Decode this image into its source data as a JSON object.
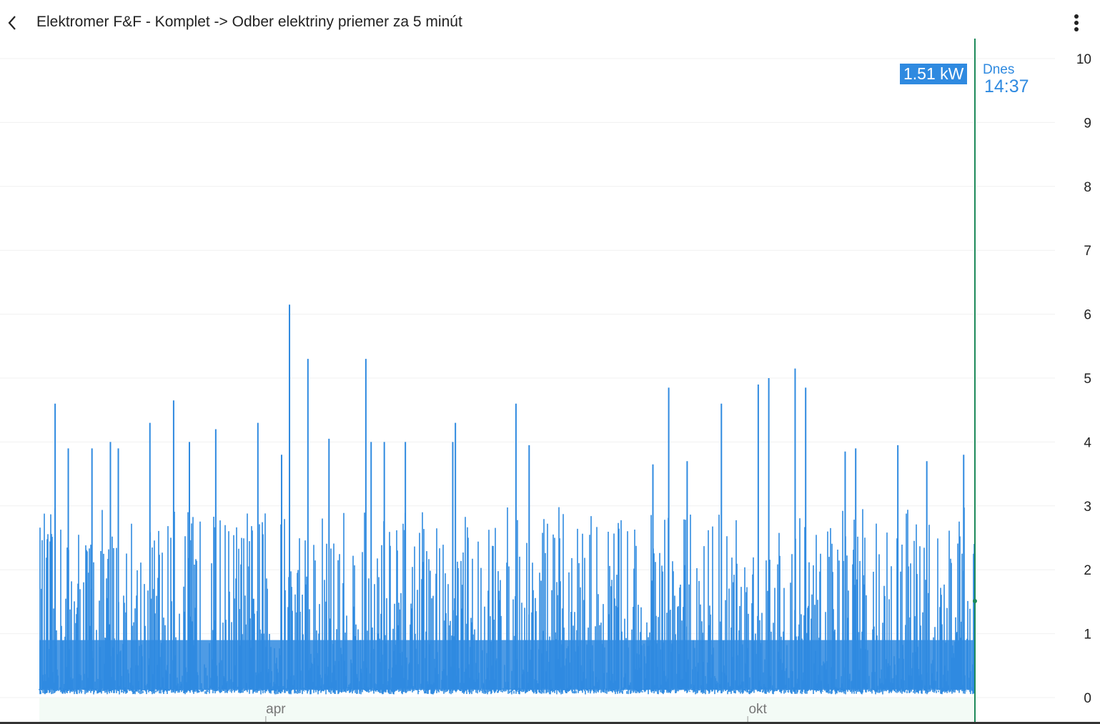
{
  "header": {
    "title": "Elektromer F&F - Komplet -> Odber elektriny priemer za 5 minút",
    "back_icon": "chevron-left-icon",
    "menu_icon": "more-vertical-icon"
  },
  "cursor": {
    "value_label": "1.51 kW",
    "day_label": "Dnes",
    "time_label": "14:37",
    "value": 1.51,
    "line_color": "#1e8a5a"
  },
  "chart_data": {
    "type": "line",
    "title": "Odber elektriny priemer za 5 minút",
    "unit": "kW",
    "series_color": "#2f8ae0",
    "ylim": [
      0,
      10
    ],
    "yticks": [
      "0",
      "1",
      "2",
      "3",
      "4",
      "5",
      "6",
      "7",
      "8",
      "9",
      "10"
    ],
    "x_domain_day_of_year": [
      5,
      360
    ],
    "xticks": [
      {
        "label": "apr",
        "day": 91
      },
      {
        "label": "okt",
        "day": 274
      }
    ],
    "typical_range": [
      0.1,
      2.5
    ],
    "peaks": [
      {
        "day": 11,
        "value": 4.6
      },
      {
        "day": 16,
        "value": 3.9
      },
      {
        "day": 25,
        "value": 3.9
      },
      {
        "day": 32,
        "value": 4.0
      },
      {
        "day": 35,
        "value": 3.9
      },
      {
        "day": 47,
        "value": 4.3
      },
      {
        "day": 56,
        "value": 4.65
      },
      {
        "day": 62,
        "value": 4.0
      },
      {
        "day": 72,
        "value": 4.2
      },
      {
        "day": 88,
        "value": 4.3
      },
      {
        "day": 97,
        "value": 3.8
      },
      {
        "day": 100,
        "value": 6.15
      },
      {
        "day": 107,
        "value": 5.3
      },
      {
        "day": 115,
        "value": 4.05
      },
      {
        "day": 129,
        "value": 5.3
      },
      {
        "day": 131,
        "value": 4.0
      },
      {
        "day": 136,
        "value": 4.0
      },
      {
        "day": 144,
        "value": 4.0
      },
      {
        "day": 162,
        "value": 4.0
      },
      {
        "day": 163,
        "value": 4.3
      },
      {
        "day": 186,
        "value": 4.6
      },
      {
        "day": 191,
        "value": 3.95
      },
      {
        "day": 238,
        "value": 3.65
      },
      {
        "day": 244,
        "value": 4.85
      },
      {
        "day": 251,
        "value": 3.7
      },
      {
        "day": 264,
        "value": 4.6
      },
      {
        "day": 278,
        "value": 4.9
      },
      {
        "day": 282,
        "value": 5.0
      },
      {
        "day": 292,
        "value": 5.15
      },
      {
        "day": 296,
        "value": 4.85
      },
      {
        "day": 311,
        "value": 3.85
      },
      {
        "day": 315,
        "value": 3.9
      },
      {
        "day": 331,
        "value": 3.95
      },
      {
        "day": 342,
        "value": 3.7
      },
      {
        "day": 356,
        "value": 3.8
      }
    ]
  }
}
